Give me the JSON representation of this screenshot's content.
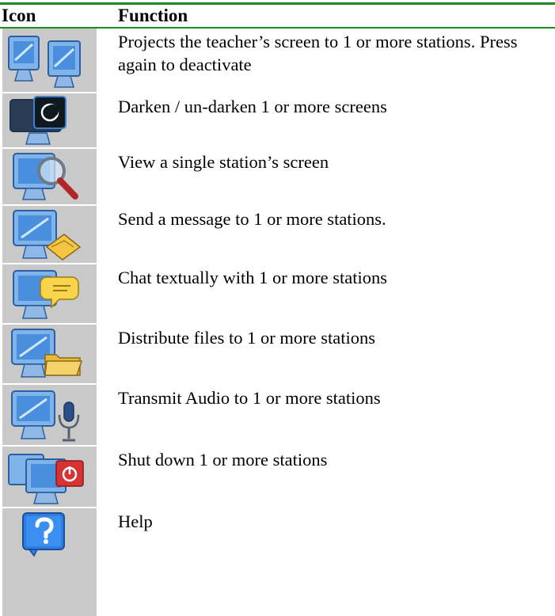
{
  "header": {
    "icon": "Icon",
    "function": "Function"
  },
  "rows": [
    {
      "icon": "project-screen-icon",
      "text": "Projects the teacher’s screen to 1 or more stations. Press again to deactivate"
    },
    {
      "icon": "darken-screen-icon",
      "text": "Darken / un-darken 1 or more screens"
    },
    {
      "icon": "view-screen-icon",
      "text": "View a single station’s screen"
    },
    {
      "icon": "send-message-icon",
      "text": "Send a message to 1 or more stations."
    },
    {
      "icon": "chat-icon",
      "text": "Chat textually with 1 or more stations"
    },
    {
      "icon": "distribute-files-icon",
      "text": "Distribute files to 1 or more stations"
    },
    {
      "icon": "transmit-audio-icon",
      "text": "Transmit Audio to 1 or more stations"
    },
    {
      "icon": "shutdown-icon",
      "text": "Shut down 1 or more stations"
    },
    {
      "icon": "help-icon",
      "text": "Help"
    }
  ],
  "colors": {
    "rule": "#1e8a1e",
    "icon_bg": "#c9c9c9",
    "screen": "#3a7fd0"
  }
}
